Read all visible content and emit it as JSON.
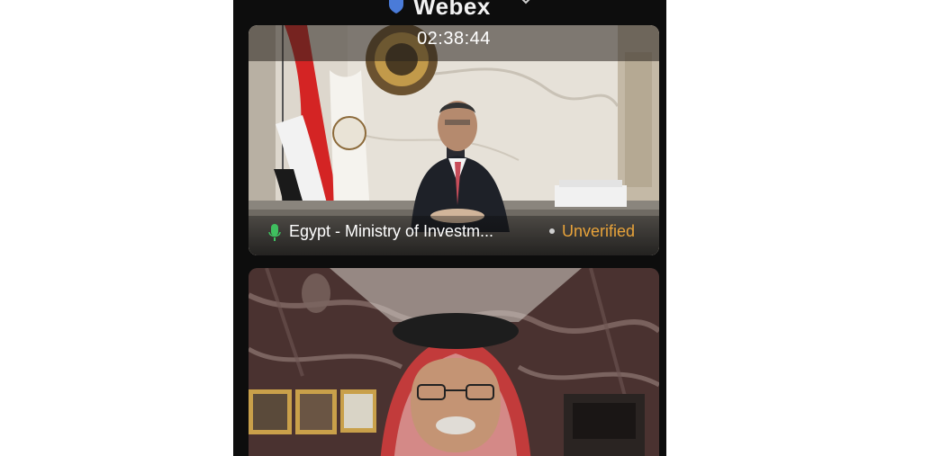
{
  "app": {
    "title": "Webex",
    "brand_color": "#f2f2f2",
    "icons": [
      "shield-icon",
      "chevron-down-icon"
    ]
  },
  "main_tile": {
    "timer": "02:38:44",
    "participant_name": "Egypt - Ministry of Investm...",
    "status": "Unverified",
    "status_color": "#e8a33a",
    "mic_icon": "microphone-icon",
    "mic_color": "#3fbf5f"
  },
  "second_tile": {}
}
